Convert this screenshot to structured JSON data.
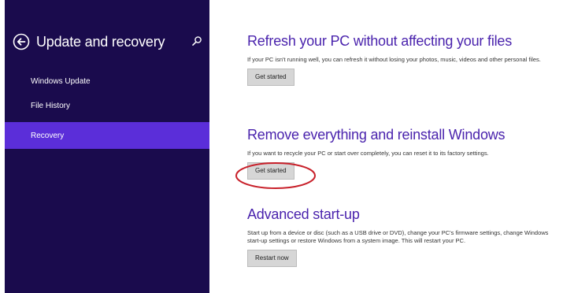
{
  "sidebar": {
    "title": "Update and recovery",
    "items": [
      {
        "label": "Windows Update",
        "selected": false
      },
      {
        "label": "File History",
        "selected": false
      },
      {
        "label": "Recovery",
        "selected": true
      }
    ],
    "background_color": "#1a0b4d",
    "selected_color": "#5b2ed9"
  },
  "main": {
    "accent_color": "#4a23ad",
    "sections": [
      {
        "title": "Refresh your PC without affecting your files",
        "description": "If your PC isn't running well, you can refresh it without losing your photos, music, videos and other personal files.",
        "button_label": "Get started"
      },
      {
        "title": "Remove everything and reinstall Windows",
        "description": "If you want to recycle your PC or start over completely, you can reset it to its factory settings.",
        "button_label": "Get started",
        "highlighted": true
      },
      {
        "title": "Advanced start-up",
        "description": "Start up from a device or disc (such as a USB drive or DVD), change your PC's firmware settings, change Windows start-up settings or restore Windows from a system image. This will restart your PC.",
        "button_label": "Restart now"
      }
    ]
  },
  "annotation": {
    "shape": "ellipse",
    "color": "#c8202a"
  },
  "icons": {
    "back": "back-arrow-circle-icon",
    "search": "search-icon"
  }
}
